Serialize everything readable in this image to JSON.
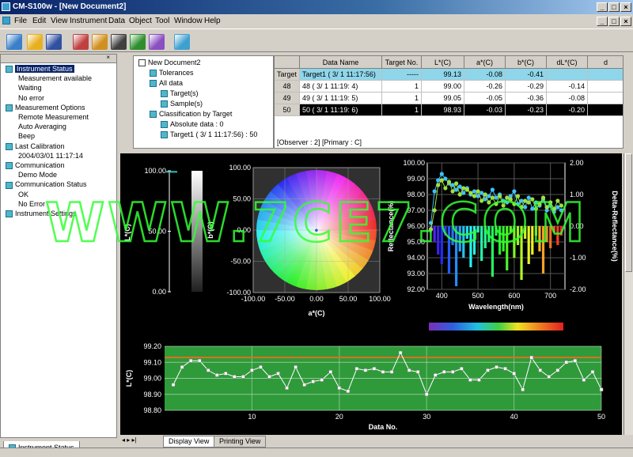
{
  "window": {
    "title": "CM-S100w - [New Document2]",
    "controls": {
      "minimize": "_",
      "maximize": "□",
      "close": "×"
    }
  },
  "menu": [
    "File",
    "Edit",
    "View",
    "Instrument",
    "Data",
    "Object",
    "Tool",
    "Window",
    "Help"
  ],
  "toolbar": {
    "icons": [
      "new-document-icon",
      "open-folder-icon",
      "save-icon",
      "instrument-icon",
      "calibrate-icon",
      "measure-icon",
      "target-icon",
      "sample-icon",
      "display-icon"
    ],
    "colors": [
      "#3b7fc8",
      "#e8b020",
      "#3050a0",
      "#c04040",
      "#d09020",
      "#404040",
      "#2f8f2f",
      "#8a4fc0",
      "#3fa0d0"
    ]
  },
  "left_panel": {
    "items": [
      {
        "label": "Instrument Status",
        "level": 0,
        "selected": true
      },
      {
        "label": "Measurement available",
        "level": 1
      },
      {
        "label": "Waiting",
        "level": 1
      },
      {
        "label": "No error",
        "level": 1
      },
      {
        "label": "Measurement Options",
        "level": 0
      },
      {
        "label": "Remote Measurement",
        "level": 1
      },
      {
        "label": "Auto Averaging",
        "level": 1
      },
      {
        "label": "Beep",
        "level": 1
      },
      {
        "label": "Last Calibration",
        "level": 0
      },
      {
        "label": "2004/03/01 11:17:14",
        "level": 1
      },
      {
        "label": "Communication",
        "level": 0
      },
      {
        "label": "Demo Mode",
        "level": 1
      },
      {
        "label": "Communication Status",
        "level": 0
      },
      {
        "label": "OK",
        "level": 1
      },
      {
        "label": "No Error",
        "level": 1
      },
      {
        "label": "Instrument Settings",
        "level": 0
      }
    ],
    "footer_tab": "Instrument Status"
  },
  "doc_tree": {
    "items": [
      {
        "label": "New Document2",
        "level": 0
      },
      {
        "label": "Tolerances",
        "level": 1
      },
      {
        "label": "All data",
        "level": 1
      },
      {
        "label": "Target(s)",
        "level": 2
      },
      {
        "label": "Sample(s)",
        "level": 2
      },
      {
        "label": "Classification by Target",
        "level": 1
      },
      {
        "label": "Absolute data : 0",
        "level": 2
      },
      {
        "label": "Target1 ( 3/ 1 11:17:56) : 50",
        "level": 2
      }
    ]
  },
  "table": {
    "columns": [
      "",
      "Data Name",
      "Target No.",
      "L*(C)",
      "a*(C)",
      "b*(C)",
      "dL*(C)",
      "d"
    ],
    "rows": [
      {
        "id": "Target",
        "name": "Target1 ( 3/ 1 11:17:56)",
        "target": "-----",
        "L": "99.13",
        "a": "-0.08",
        "b": "-0.41",
        "dL": "",
        "highlight": "target"
      },
      {
        "id": "48",
        "name": "48 ( 3/ 1 11:19: 4)",
        "target": "1",
        "L": "99.00",
        "a": "-0.26",
        "b": "-0.29",
        "dL": "-0.14"
      },
      {
        "id": "49",
        "name": "49 ( 3/ 1 11:19: 5)",
        "target": "1",
        "L": "99.05",
        "a": "-0.05",
        "b": "-0.36",
        "dL": "-0.08"
      },
      {
        "id": "50",
        "name": "50 ( 3/ 1 11:19: 6)",
        "target": "1",
        "L": "98.93",
        "a": "-0.03",
        "b": "-0.23",
        "dL": "-0.20",
        "highlight": "selected"
      }
    ],
    "observer_line": "[Observer : 2]  [Primary : C]"
  },
  "view_tabs": [
    "Display View",
    "Printing View"
  ],
  "watermark": "WWW.7CE7.COM",
  "chart_data": [
    {
      "type": "bar",
      "name": "lightness-scale",
      "ylabel": "L*(C)",
      "ylim": [
        0,
        100
      ],
      "yticks": [
        "100.00",
        "50.00",
        "0.00"
      ],
      "values": [
        99.13
      ]
    },
    {
      "type": "scatter",
      "name": "ab-color-plane",
      "xlabel": "a*(C)",
      "ylabel": "b*(C)",
      "xlim": [
        -100,
        100
      ],
      "ylim": [
        -100,
        100
      ],
      "xticks": [
        "-100.00",
        "-50.00",
        "0.00",
        "50.00",
        "100.00"
      ],
      "yticks": [
        "100.00",
        "50.00",
        "0.00",
        "-50.00",
        "-100.00"
      ],
      "points": [
        [
          -0.08,
          -0.41
        ],
        [
          -0.26,
          -0.29
        ],
        [
          -0.05,
          -0.36
        ],
        [
          -0.03,
          -0.23
        ]
      ]
    },
    {
      "type": "line",
      "name": "spectral-reflectance",
      "xlabel": "Wavelength(nm)",
      "ylabel": "Reflectance(%)",
      "y2label": "Delta-Reflectance(%)",
      "xlim": [
        360,
        740
      ],
      "ylim": [
        92,
        100
      ],
      "y2lim": [
        -2,
        2
      ],
      "xticks": [
        "400",
        "500",
        "600",
        "700"
      ],
      "yticks": [
        "100.00",
        "99.00",
        "98.00",
        "97.00",
        "96.00",
        "95.00",
        "94.00",
        "93.00",
        "92.00"
      ],
      "y2ticks": [
        "2.00",
        "1.00",
        "0.00",
        "-1.00",
        "-2.00"
      ],
      "x": [
        370,
        380,
        390,
        400,
        410,
        420,
        430,
        440,
        450,
        460,
        470,
        480,
        490,
        500,
        510,
        520,
        530,
        540,
        550,
        560,
        570,
        580,
        590,
        600,
        610,
        620,
        630,
        640,
        650,
        660,
        670,
        680,
        690,
        700,
        710,
        720,
        730
      ],
      "series": [
        {
          "values": [
            96.2,
            98.2,
            98.9,
            99.3,
            99.0,
            98.7,
            98.6,
            98.3,
            98.5,
            98.1,
            98.4,
            98.0,
            98.2,
            97.9,
            98.1,
            97.7,
            97.9,
            98.3,
            97.8,
            98.0,
            97.6,
            97.5,
            97.9,
            98.2,
            97.4,
            97.6,
            97.2,
            97.8,
            97.1,
            97.5,
            97.3,
            97.7,
            97.0,
            97.3,
            96.9,
            97.2,
            97.0
          ]
        },
        {
          "values": [
            95.8,
            97.0,
            98.6,
            98.9,
            98.4,
            98.8,
            98.2,
            98.7,
            98.0,
            98.4,
            98.3,
            98.1,
            97.9,
            98.2,
            97.6,
            98.0,
            97.5,
            97.8,
            97.4,
            97.9,
            97.3,
            97.8,
            97.7,
            97.4,
            97.9,
            97.2,
            97.6,
            97.5,
            97.7,
            97.1,
            97.4,
            97.8,
            97.2,
            97.5,
            97.1,
            97.6,
            97.3
          ]
        }
      ],
      "delta_bars": [
        -0.2,
        -0.5,
        -0.9,
        -1.2,
        -0.3,
        -1.5,
        -0.6,
        -1.9,
        -0.8,
        -1.0,
        -0.4,
        -1.3,
        -0.9,
        -0.2,
        -1.1,
        -0.7,
        -0.5,
        -1.6,
        -0.3,
        -0.9,
        -0.8,
        -1.4,
        -0.2,
        -1.0,
        -0.6,
        -1.7,
        -0.4,
        -1.2,
        -0.9,
        -0.3,
        -0.8,
        -1.5,
        -0.5,
        -0.7,
        -0.2,
        -0.6,
        -0.3
      ]
    },
    {
      "type": "line",
      "name": "L-trend",
      "xlabel": "Data No.",
      "ylabel": "L*(C)",
      "xlim": [
        0,
        50
      ],
      "ylim": [
        98.8,
        99.2
      ],
      "xticks": [
        "10",
        "20",
        "30",
        "40",
        "50"
      ],
      "yticks": [
        "99.20",
        "99.10",
        "99.00",
        "98.90",
        "98.80"
      ],
      "target": 99.13,
      "x": [
        1,
        2,
        3,
        4,
        5,
        6,
        7,
        8,
        9,
        10,
        11,
        12,
        13,
        14,
        15,
        16,
        17,
        18,
        19,
        20,
        21,
        22,
        23,
        24,
        25,
        26,
        27,
        28,
        29,
        30,
        31,
        32,
        33,
        34,
        35,
        36,
        37,
        38,
        39,
        40,
        41,
        42,
        43,
        44,
        45,
        46,
        47,
        48,
        49,
        50
      ],
      "values": [
        98.96,
        99.07,
        99.11,
        99.11,
        99.05,
        99.02,
        99.03,
        99.01,
        99.01,
        99.05,
        99.07,
        99.01,
        99.03,
        98.94,
        99.07,
        98.96,
        98.98,
        98.99,
        99.04,
        98.94,
        98.92,
        99.06,
        99.05,
        99.06,
        99.04,
        99.04,
        99.16,
        99.05,
        99.04,
        98.9,
        99.02,
        99.04,
        99.04,
        99.06,
        98.99,
        98.99,
        99.05,
        99.07,
        99.06,
        99.03,
        98.93,
        99.13,
        99.05,
        99.01,
        99.05,
        99.1,
        99.11,
        98.99,
        99.04,
        98.93
      ]
    }
  ]
}
